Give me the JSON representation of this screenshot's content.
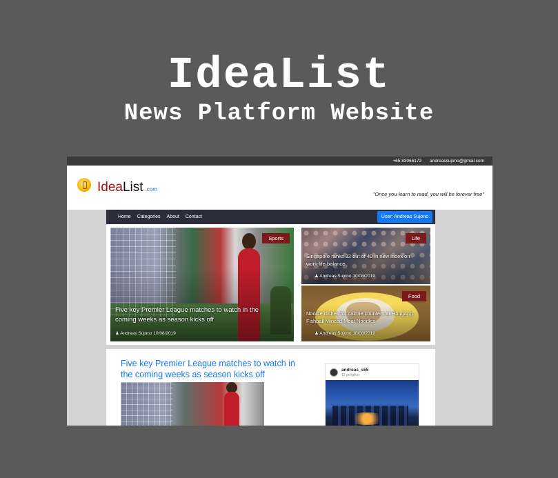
{
  "hero": {
    "title": "IdeaList",
    "subtitle": "News Platform Website"
  },
  "topbar": {
    "phone": "+65 83066172",
    "email": "andreassujono@gmail.com"
  },
  "header": {
    "logo_idea": "Idea",
    "logo_list": "List",
    "logo_com": ".com",
    "quote": "\"Once you learn to read, you will be forever free\""
  },
  "nav": {
    "items": [
      "Home",
      "Categories",
      "About",
      "Contact"
    ],
    "user_button": "User: Andreas Sujono"
  },
  "featured": {
    "main": {
      "tag": "Sports",
      "title": "Five key Premier League matches to watch in the coming weeks as season kicks off",
      "meta": "Andreas Sujono 10/08/2019"
    },
    "side": [
      {
        "tag": "Life",
        "title": "Singapore ranks 32 out of 40 in new index on work-life balance",
        "meta": "Andreas Sujono 10/08/2019"
      },
      {
        "tag": "Food",
        "title": "Noodle dishes for calorie counters at Hougang Fishball Minced Meat Noodles",
        "meta": "Andreas Sujono 10/08/2019"
      }
    ]
  },
  "article": {
    "title": "Five key Premier League matches to watch in the coming weeks as season kicks off"
  },
  "instagram": {
    "username": "andreas_s55",
    "sub": "12 pengikut"
  },
  "colors": {
    "brand": "#a01010",
    "accent": "#1479f0",
    "nav_bg": "#2c2c3a",
    "tag_bg": "#7a1a1a"
  }
}
